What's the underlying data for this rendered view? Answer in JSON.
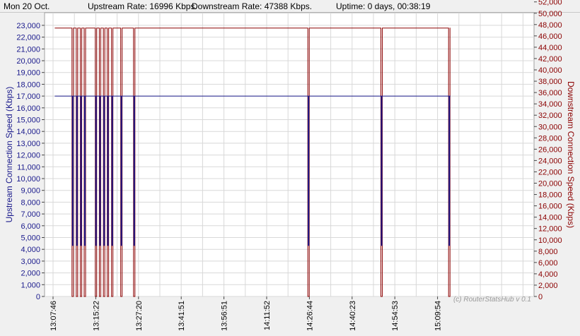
{
  "status": {
    "date": "Mon 20 Oct.",
    "upstream": "Upstream Rate: 16996 Kbps.",
    "downstream": "Downstream Rate: 47388 Kbps.",
    "uptime": "Uptime: 0 days, 00:38:19"
  },
  "watermark": "(c) RouterStatsHub v 0.1",
  "colors": {
    "upstream": "#1a1a8c",
    "downstream": "#8b0000",
    "grid": "#d8d8d8",
    "plot_bg": "#ffffff"
  },
  "chart_data": {
    "type": "line",
    "xlabel": "",
    "ylabel_left": "Upstream Connection Speed (Kbps)",
    "ylabel_right": "Downstream Connection Speed (Kbps)",
    "ylim_left": [
      0,
      24000
    ],
    "ylim_right": [
      0,
      53000
    ],
    "grid": true,
    "x_ticks": [
      {
        "t": 0,
        "label": "13:07:46"
      },
      {
        "t": 2,
        "label": "13:15:22"
      },
      {
        "t": 4,
        "label": "13:27:20"
      },
      {
        "t": 6,
        "label": "13:41:51"
      },
      {
        "t": 8,
        "label": "13:56:51"
      },
      {
        "t": 10,
        "label": "14:11:52"
      },
      {
        "t": 12,
        "label": "14:26:44"
      },
      {
        "t": 14,
        "label": "14:40:23"
      },
      {
        "t": 16,
        "label": "14:54:53"
      },
      {
        "t": 18,
        "label": "15:09:54"
      }
    ],
    "y_ticks_left": [
      0,
      1000,
      2000,
      3000,
      4000,
      5000,
      6000,
      7000,
      8000,
      9000,
      10000,
      11000,
      12000,
      13000,
      14000,
      15000,
      16000,
      17000,
      18000,
      19000,
      20000,
      21000,
      22000,
      23000
    ],
    "y_ticks_right": [
      0,
      2000,
      4000,
      6000,
      8000,
      10000,
      12000,
      14000,
      16000,
      18000,
      20000,
      22000,
      24000,
      26000,
      28000,
      30000,
      32000,
      34000,
      36000,
      38000,
      40000,
      42000,
      44000,
      46000,
      48000,
      50000,
      52000
    ],
    "baseline": {
      "upstream": 16996,
      "downstream": 47388
    },
    "x_start": 0.08,
    "x_end": 18.6,
    "drops": [
      0.92,
      1.12,
      1.31,
      1.49,
      2.01,
      2.2,
      2.39,
      2.57,
      2.77,
      3.2,
      3.8,
      11.96,
      15.38,
      18.55
    ],
    "series": [
      {
        "name": "Upstream",
        "axis": "left",
        "baseline": 16996
      },
      {
        "name": "Downstream",
        "axis": "right",
        "baseline": 47388
      }
    ]
  }
}
